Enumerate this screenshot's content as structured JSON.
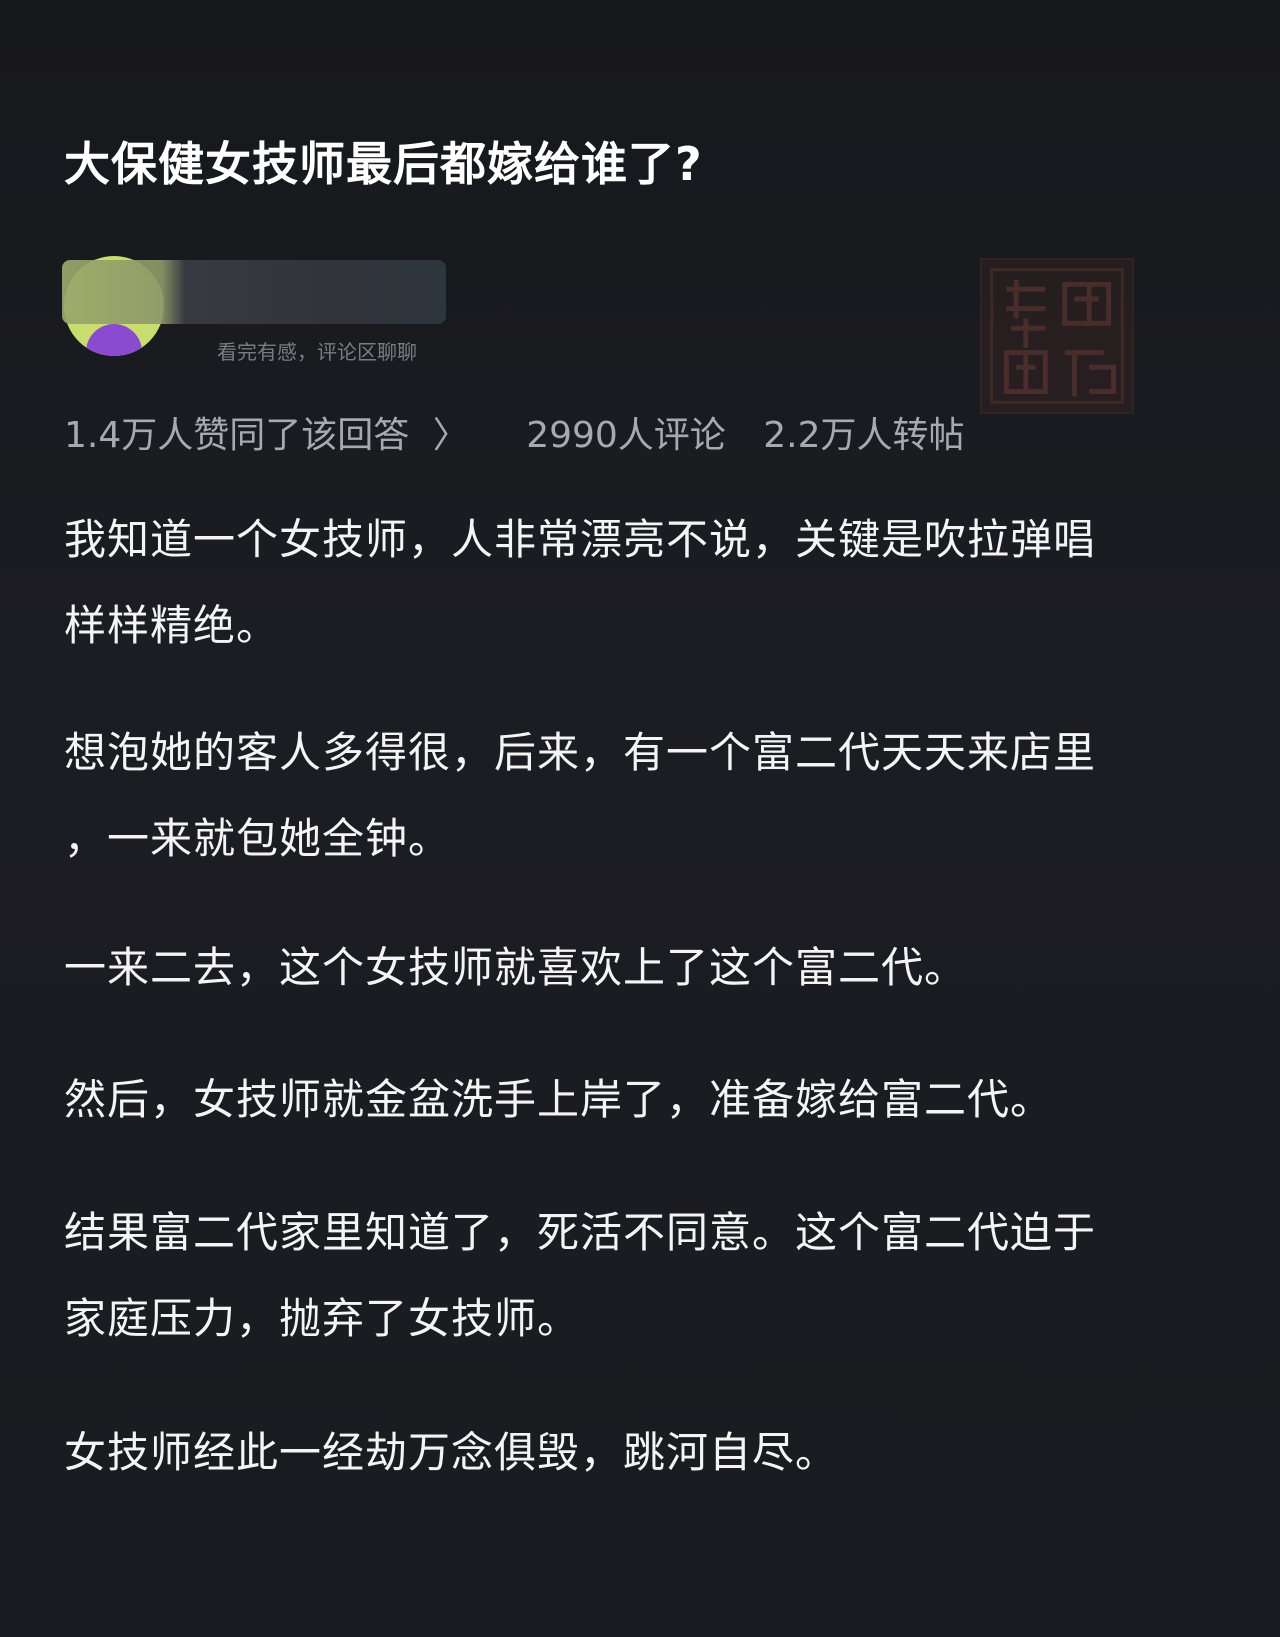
{
  "title": "大保健女技师最后都嫁给谁了?",
  "author": {
    "signature": "看完有感，评论区聊聊"
  },
  "seal": {
    "label": "印章"
  },
  "stats": {
    "approve": "1.4万人赞同了该回答",
    "chevron": "〉",
    "comments": "2990人评论",
    "reposts": "2.2万人转帖"
  },
  "content": {
    "p1": [
      "我知道一个女技师，人非常漂亮不说，关键是吹拉弹唱",
      "样样精绝。"
    ],
    "p2": [
      "想泡她的客人多得很，后来，有一个富二代天天来店里",
      "，一来就包她全钟。"
    ],
    "p3": [
      "一来二去，这个女技师就喜欢上了这个富二代。"
    ],
    "p4": [
      "然后，女技师就金盆洗手上岸了，准备嫁给富二代。"
    ],
    "p5": [
      "结果富二代家里知道了，死活不同意。这个富二代迫于",
      "家庭压力，抛弃了女技师。"
    ],
    "p6": [
      "女技师经此一经劫万念俱毁，跳河自尽。"
    ]
  },
  "colors": {
    "background": "#1a1b1f",
    "text": "#f4f4f4",
    "muted": "#a8a9ae",
    "avatar": "#c9dd6e",
    "avatar_figure": "#8a4bd1"
  }
}
